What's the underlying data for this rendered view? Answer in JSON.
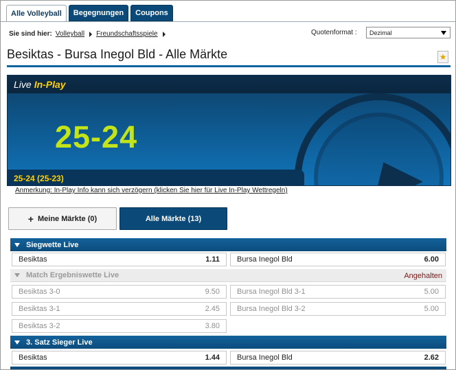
{
  "tabs": [
    {
      "label": "Alle Volleyball",
      "active": true
    },
    {
      "label": "Begegnungen",
      "active": false
    },
    {
      "label": "Coupons",
      "active": false
    }
  ],
  "breadcrumb": {
    "label": "Sie sind hier:",
    "items": [
      "Volleyball",
      "Freundschaftsspiele"
    ]
  },
  "odds_format": {
    "label": "Quotenformat :",
    "selected": "Dezimal"
  },
  "page_title": "Besiktas - Bursa Inegol Bld - Alle Märkte",
  "live": {
    "label_live": "Live",
    "label_inplay": "In-Play",
    "score": "25-24",
    "set_score": "25-24 (25-23)"
  },
  "note": "Anmerkung: In-Play Info kann sich verzögern (klicken Sie hier für Live In-Play Wettregeln)",
  "market_buttons": {
    "mine": "Meine Märkte (0)",
    "all": "Alle Märkte (13)"
  },
  "sections": [
    {
      "title": "Siegwette Live",
      "status": "",
      "selections": [
        {
          "name": "Besiktas",
          "price": "1.11"
        },
        {
          "name": "Bursa Inegol Bld",
          "price": "6.00"
        }
      ]
    },
    {
      "title": "Match Ergebniswette Live",
      "status": "Angehalten",
      "selections": [
        {
          "name": "Besiktas 3-0",
          "price": "9.50"
        },
        {
          "name": "Bursa Inegol Bld 3-1",
          "price": "5.00"
        },
        {
          "name": "Besiktas 3-1",
          "price": "2.45"
        },
        {
          "name": "Bursa Inegol Bld 3-2",
          "price": "5.00"
        },
        {
          "name": "Besiktas 3-2",
          "price": "3.80"
        }
      ]
    },
    {
      "title": "3. Satz Sieger Live",
      "status": "",
      "selections": [
        {
          "name": "Besiktas",
          "price": "1.44"
        },
        {
          "name": "Bursa Inegol Bld",
          "price": "2.62"
        }
      ]
    }
  ],
  "colors": {
    "brand_blue": "#0b4a78",
    "score_yellow_green": "#c4e41a",
    "inplay_yellow": "#ffd200",
    "suspended_red": "#7a1616"
  }
}
